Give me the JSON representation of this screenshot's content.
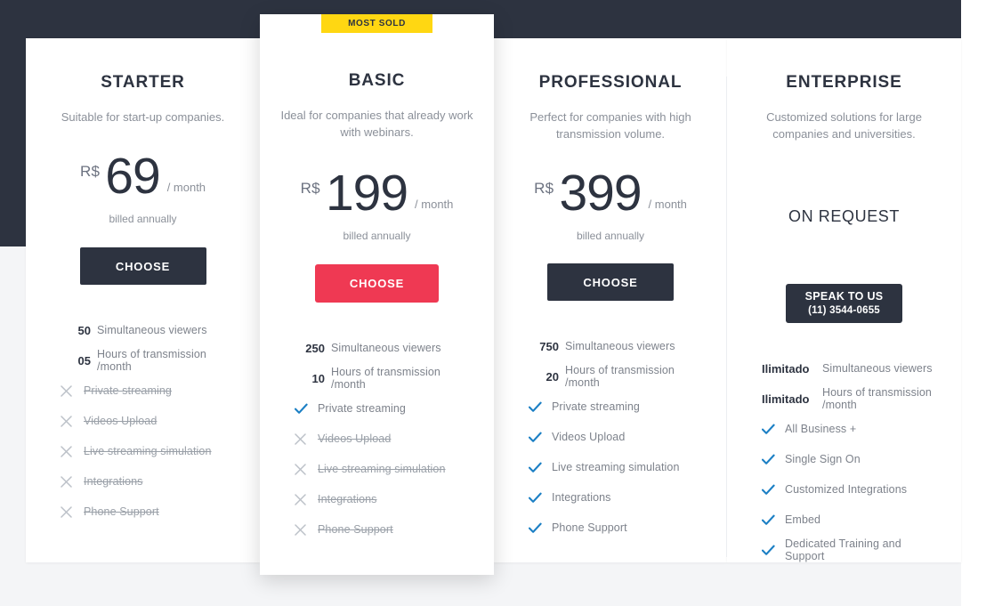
{
  "theme": {
    "dark_navy": "#2d3340",
    "page_light": "#f4f5f7",
    "accent_red": "#ef3953",
    "badge_yellow": "#ffd712",
    "check_blue": "#1b7fc4",
    "muted_text": "#8b9099"
  },
  "badge": {
    "label": "MOST SOLD"
  },
  "plans": [
    {
      "id": "starter",
      "title": "STARTER",
      "description": "Suitable for start-up companies.",
      "currency": "R$",
      "amount": "69",
      "period": "/ month",
      "billing_note": "billed annually",
      "cta": {
        "label": "CHOOSE",
        "style": "dark"
      },
      "features": [
        {
          "mark": "50",
          "type": "number",
          "label": "Simultaneous viewers",
          "enabled": true
        },
        {
          "mark": "05",
          "type": "number",
          "label": "Hours of transmission /month",
          "enabled": true
        },
        {
          "mark": "x",
          "type": "cross",
          "label": "Private streaming",
          "enabled": false
        },
        {
          "mark": "x",
          "type": "cross",
          "label": "Videos Upload",
          "enabled": false
        },
        {
          "mark": "x",
          "type": "cross",
          "label": "Live streaming simulation",
          "enabled": false
        },
        {
          "mark": "x",
          "type": "cross",
          "label": "Integrations",
          "enabled": false
        },
        {
          "mark": "x",
          "type": "cross",
          "label": "Phone Support",
          "enabled": false
        }
      ]
    },
    {
      "id": "basic",
      "title": "BASIC",
      "description": "Ideal for companies that already work with webinars.",
      "currency": "R$",
      "amount": "199",
      "period": "/ month",
      "billing_note": "billed annually",
      "cta": {
        "label": "CHOOSE",
        "style": "red"
      },
      "features": [
        {
          "mark": "250",
          "type": "number",
          "label": "Simultaneous viewers",
          "enabled": true
        },
        {
          "mark": "10",
          "type": "number",
          "label": "Hours of transmission /month",
          "enabled": true
        },
        {
          "mark": "v",
          "type": "check",
          "label": "Private streaming",
          "enabled": true
        },
        {
          "mark": "x",
          "type": "cross",
          "label": "Videos Upload",
          "enabled": false
        },
        {
          "mark": "x",
          "type": "cross",
          "label": "Live streaming simulation",
          "enabled": false
        },
        {
          "mark": "x",
          "type": "cross",
          "label": "Integrations",
          "enabled": false
        },
        {
          "mark": "x",
          "type": "cross",
          "label": "Phone Support",
          "enabled": false
        }
      ]
    },
    {
      "id": "professional",
      "title": "PROFESSIONAL",
      "description": "Perfect for companies with high transmission volume.",
      "currency": "R$",
      "amount": "399",
      "period": "/ month",
      "billing_note": "billed annually",
      "cta": {
        "label": "CHOOSE",
        "style": "dark"
      },
      "features": [
        {
          "mark": "750",
          "type": "number",
          "label": "Simultaneous viewers",
          "enabled": true
        },
        {
          "mark": "20",
          "type": "number",
          "label": "Hours of transmission /month",
          "enabled": true
        },
        {
          "mark": "v",
          "type": "check",
          "label": "Private streaming",
          "enabled": true
        },
        {
          "mark": "v",
          "type": "check",
          "label": "Videos Upload",
          "enabled": true
        },
        {
          "mark": "v",
          "type": "check",
          "label": "Live streaming simulation",
          "enabled": true
        },
        {
          "mark": "v",
          "type": "check",
          "label": "Integrations",
          "enabled": true
        },
        {
          "mark": "v",
          "type": "check",
          "label": "Phone Support",
          "enabled": true
        }
      ]
    },
    {
      "id": "enterprise",
      "title": "ENTERPRISE",
      "description": "Customized solutions for large companies and universities.",
      "price_text": "ON REQUEST",
      "cta": {
        "label": "SPEAK TO US",
        "phone": "(11) 3544-0655",
        "style": "contact"
      },
      "features": [
        {
          "mark": "Ilimitado",
          "type": "number-wide",
          "label": "Simultaneous viewers",
          "enabled": true
        },
        {
          "mark": "Ilimitado",
          "type": "number-wide",
          "label": "Hours of transmission /month",
          "enabled": true
        },
        {
          "mark": "v",
          "type": "check",
          "label": "All Business +",
          "enabled": true
        },
        {
          "mark": "v",
          "type": "check",
          "label": "Single Sign On",
          "enabled": true
        },
        {
          "mark": "v",
          "type": "check",
          "label": "Customized Integrations",
          "enabled": true
        },
        {
          "mark": "v",
          "type": "check",
          "label": "Embed",
          "enabled": true
        },
        {
          "mark": "v",
          "type": "check",
          "label": "Dedicated Training and Support",
          "enabled": true
        }
      ]
    }
  ]
}
